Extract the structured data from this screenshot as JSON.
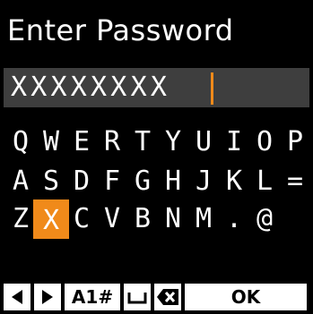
{
  "title": "Enter Password",
  "password": {
    "value": "XXXXXXXX"
  },
  "keyboard": {
    "rows": [
      [
        "Q",
        "W",
        "E",
        "R",
        "T",
        "Y",
        "U",
        "I",
        "O",
        "P"
      ],
      [
        "A",
        "S",
        "D",
        "F",
        "G",
        "H",
        "J",
        "K",
        "L",
        "="
      ],
      [
        "Z",
        "X",
        "C",
        "V",
        "B",
        "N",
        "M",
        ".",
        "@"
      ]
    ],
    "selected_key": "X"
  },
  "toolbar": {
    "left_icon": "left-arrow-icon",
    "right_icon": "right-arrow-icon",
    "mode_label": "A1#",
    "space_icon": "space-icon",
    "backspace_icon": "backspace-icon",
    "ok_label": "OK"
  },
  "colors": {
    "accent": "#f08a1a",
    "field_background": "#3e3e3e",
    "background": "#000000"
  }
}
